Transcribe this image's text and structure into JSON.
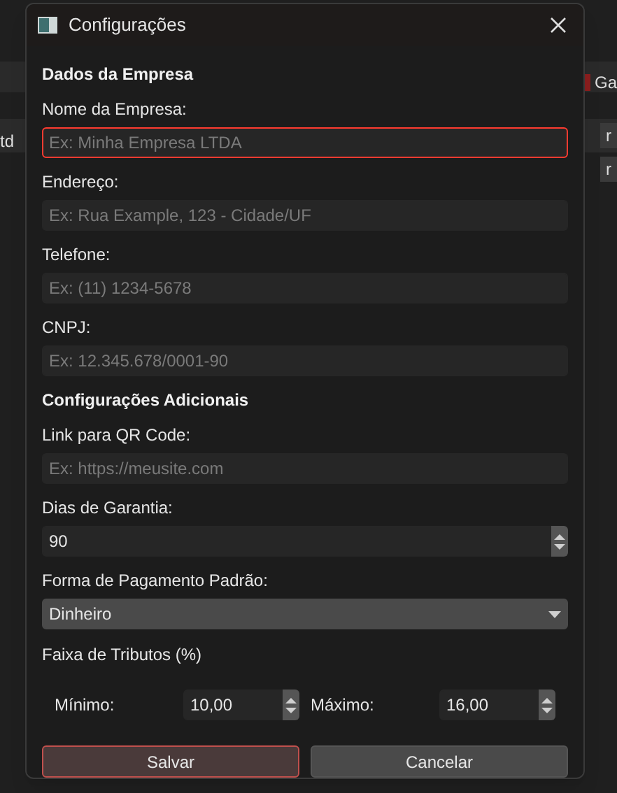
{
  "background": {
    "fragments": [
      {
        "kind": "checkbox-label",
        "text": "Ga",
        "checked": true
      },
      {
        "kind": "cell",
        "text": "td"
      },
      {
        "kind": "button",
        "text": "r"
      },
      {
        "kind": "button",
        "text": "r"
      }
    ]
  },
  "window": {
    "title": "Configurações"
  },
  "sections": [
    {
      "title": "Dados da Empresa",
      "fields": [
        {
          "kind": "text",
          "label": "Nome da Empresa:",
          "placeholder": "Ex: Minha Empresa LTDA",
          "focused": true
        },
        {
          "kind": "text",
          "label": "Endereço:",
          "placeholder": "Ex: Rua Example, 123 - Cidade/UF",
          "focused": false
        },
        {
          "kind": "text",
          "label": "Telefone:",
          "placeholder": "Ex: (11) 1234-5678",
          "focused": false
        },
        {
          "kind": "text",
          "label": "CNPJ:",
          "placeholder": "Ex: 12.345.678/0001-90",
          "focused": false
        }
      ]
    },
    {
      "title": "Configurações Adicionais",
      "fields": [
        {
          "kind": "text",
          "label": "Link para QR Code:",
          "placeholder": "Ex: https://meusite.com",
          "focused": false
        },
        {
          "kind": "spin",
          "label": "Dias de Garantia:",
          "value": "90",
          "focused": false
        },
        {
          "kind": "combo",
          "label": "Forma de Pagamento Padrão:",
          "value": "Dinheiro",
          "focused": false
        }
      ]
    }
  ],
  "tax_range": {
    "title": "Faixa de Tributos (%)",
    "min_label": "Mínimo:",
    "min_value": "10,00",
    "max_label": "Máximo:",
    "max_value": "16,00"
  },
  "buttons": [
    {
      "label": "Salvar",
      "selected": true
    },
    {
      "label": "Cancelar",
      "selected": false
    }
  ]
}
